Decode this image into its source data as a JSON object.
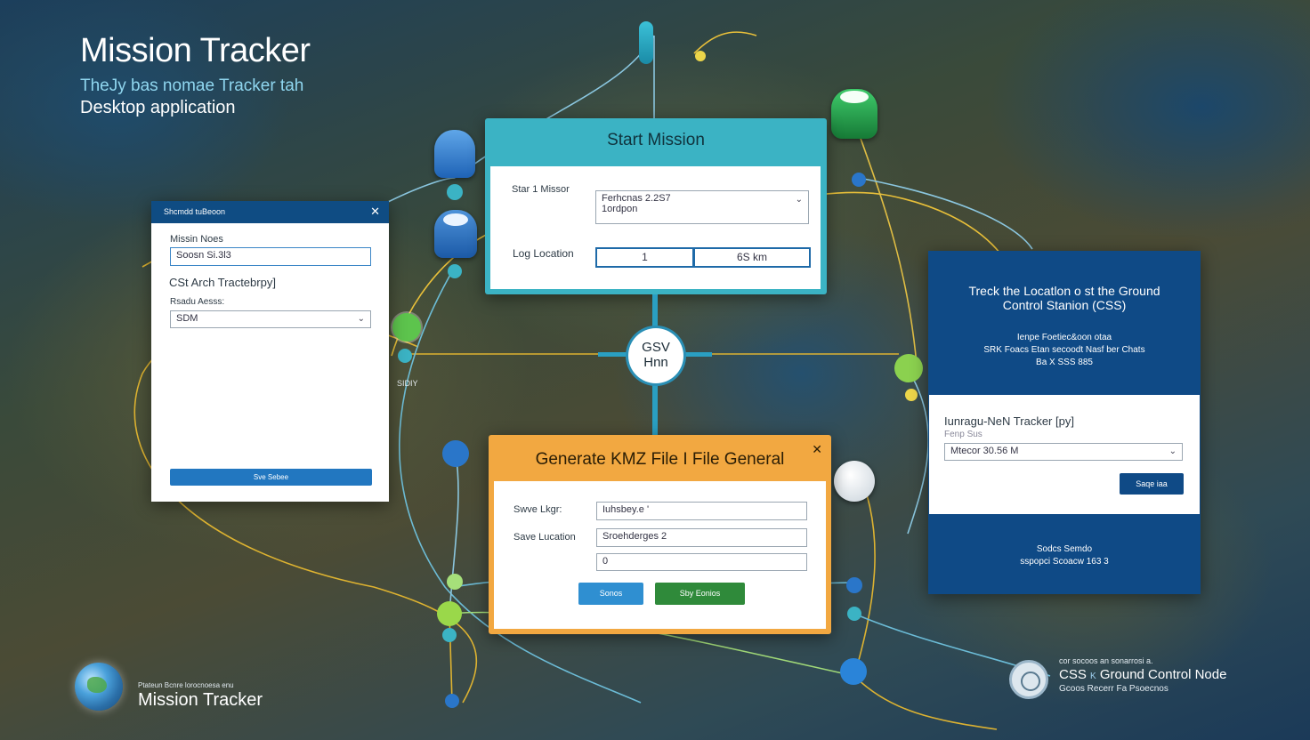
{
  "app": {
    "title": "Mission Tracker",
    "subtitle_line1": "TheJy bas nomae Tracker tah",
    "subtitle_line2": "Desktop application"
  },
  "left_panel": {
    "header": "Shcmdd tuBeoon",
    "mission_label": "Missin Noes",
    "mission_value": "Soosn Si.3l3",
    "section_heading": "CSt Arch Tractebrpy]",
    "select_label": "Rsadu Aesss:",
    "select_value": "SDM",
    "action_button": "Sve Sebee"
  },
  "start_mission": {
    "title": "Start Mission",
    "row1_label": "Star 1 Missor",
    "row1_value_line1": "Ferhcnas 2.2S7",
    "row1_value_line2": "1ordpon",
    "row2_label": "Log Location",
    "row2_value_a": "1",
    "row2_value_b": "6S km"
  },
  "kmz_panel": {
    "title": "Generate KMZ File I File General",
    "save_log_label": "Swve Lkgr:",
    "save_log_value": "Iuhsbey.e '",
    "save_location_label": "Save Lucation",
    "save_location_value": "Sroehderges 2",
    "third_value": "0",
    "cancel_button": "Sonos",
    "save_button": "Sby Eonios"
  },
  "right_panel": {
    "heading_line1": "Treck the Locatlon o st the Ground",
    "heading_line2": "Control Stanion (CSS)",
    "info_line1": "Ienpe Foetiec&oon otaa",
    "info_line2": "SRK Foacs Etan secoodt Nasf ber Chats",
    "info_line3": "Ba X SSS 885",
    "tracker_label": "Iunragu-NeN Tracker [py]",
    "tracker_sub": "Fenp Sus",
    "select_value": "Mtecor 30.56 M",
    "small_button": "Saqe iaa",
    "footer_line1": "Sodcs Semdo",
    "footer_line2": "sspopci Scoacw 163 3"
  },
  "center_node": {
    "line1": "GSV",
    "line2": "Hnn"
  },
  "map_labels": {
    "node_label": "SIDIY"
  },
  "bottom_left": {
    "small_text": "Ptateun Bcnre lorocnoesa enu",
    "title": "Mission Tracker"
  },
  "bottom_right": {
    "top_line": "cor socoos an sonarrosi a.",
    "gcs_prefix": "CSS",
    "gcs_mid": "K",
    "gcs_title": "Ground Control Node",
    "bottom_line": "Gcoos Recerr Fa Psoecnos"
  },
  "colors": {
    "left_header": "#0f4c83",
    "start_accent": "#3bb3c4",
    "kmz_accent": "#f2a841",
    "right_panel": "#0f4a86",
    "cancel_button": "#2f8fd1",
    "save_button": "#2f8a3a"
  }
}
